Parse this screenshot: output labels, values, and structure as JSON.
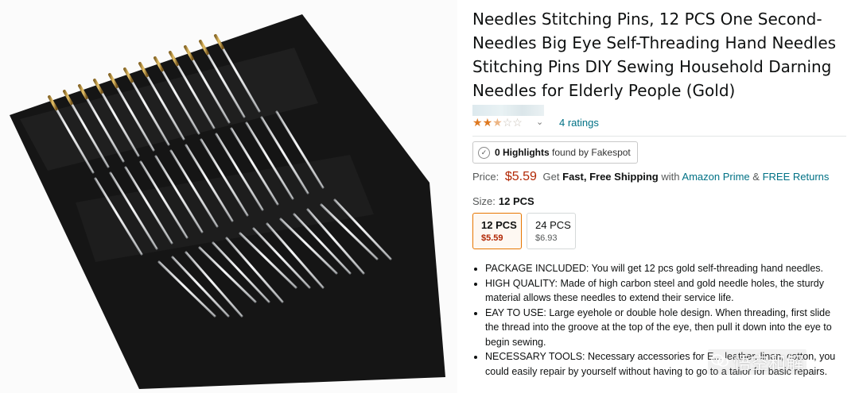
{
  "product": {
    "title": "Needles Stitching Pins, 12 PCS One Second-Needles Big Eye Self-Threading Hand Needles Stitching Pins DIY Sewing Household Darning Needles for Elderly People (Gold)",
    "image_alt": "Product photo of self-threading needles on black card",
    "rating": 2.5,
    "ratings_text": "4 ratings"
  },
  "fakespot": {
    "count": "0 Highlights",
    "suffix": "found by Fakespot"
  },
  "price": {
    "label": "Price:",
    "value": "$5.59",
    "get_text": "Get",
    "shipping": "Fast, Free Shipping",
    "with_text": "with",
    "prime_link": "Amazon Prime",
    "amp": "&",
    "returns_link": "FREE Returns"
  },
  "size": {
    "label": "Size:",
    "selected": "12 PCS",
    "options": [
      {
        "name": "12 PCS",
        "price": "$5.59"
      },
      {
        "name": "24 PCS",
        "price": "$6.93"
      }
    ]
  },
  "features": [
    "PACKAGE INCLUDED: You will get 12 pcs gold self-threading hand needles.",
    "HIGH QUALITY: Made of high carbon steel and gold needle holes, the sturdy material allows these needles to extend their service life.",
    "EAY TO USE: Large eyehole or double hole design. When threading, first slide the thread into the groove at the top of the eye, then pull it down into the eye to begin sewing.",
    "NECESSARY TOOLS: Necessary accessories for E... leather, linen, cotton, you could easily repair by yourself without having to go to a tailor for basic repairs."
  ],
  "watermark": {
    "text": "悟空和解"
  },
  "colors": {
    "accent_orange": "#e77600",
    "price_red": "#b12704",
    "link_teal": "#007185",
    "star_orange": "#de7921"
  }
}
